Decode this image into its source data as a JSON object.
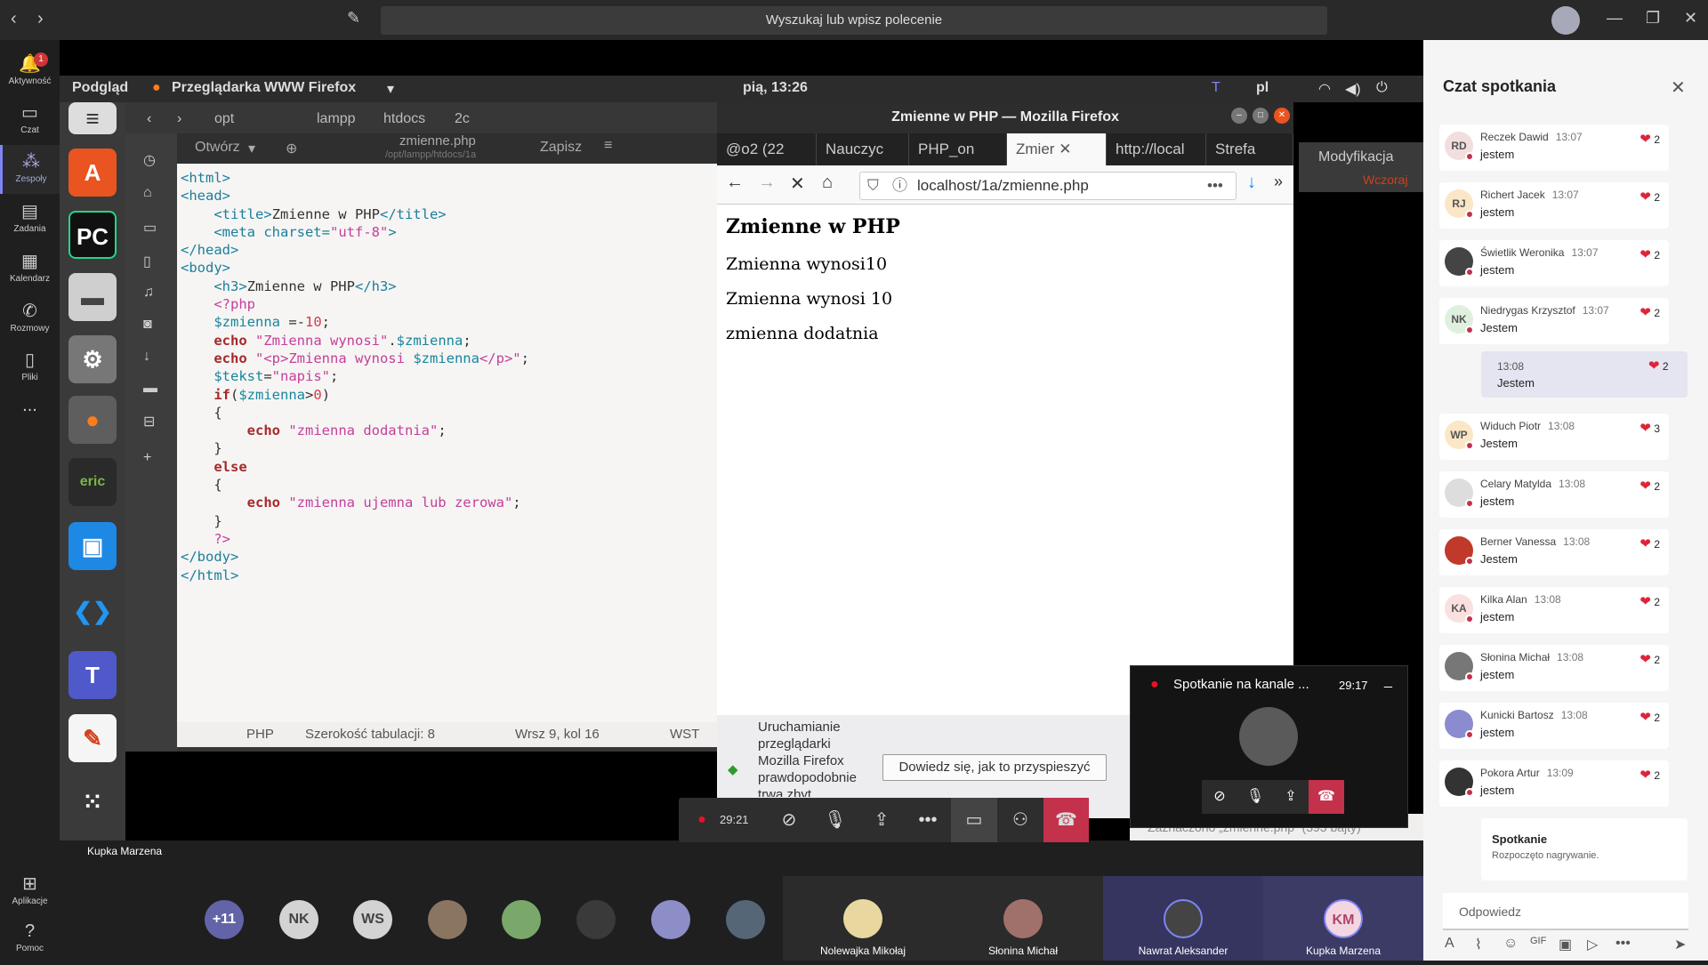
{
  "teams": {
    "search_placeholder": "Wyszukaj lub wpisz polecenie",
    "rail": [
      {
        "label": "Aktywność",
        "icon": "bell-icon",
        "badge": "1"
      },
      {
        "label": "Czat",
        "icon": "chat-icon"
      },
      {
        "label": "Zespoły",
        "icon": "teams-icon"
      },
      {
        "label": "Zadania",
        "icon": "assignments-icon"
      },
      {
        "label": "Kalendarz",
        "icon": "calendar-icon"
      },
      {
        "label": "Rozmowy",
        "icon": "phone-icon"
      },
      {
        "label": "Pliki",
        "icon": "files-icon"
      },
      {
        "label": "...",
        "icon": "more-icon"
      }
    ],
    "rail_bottom": [
      {
        "label": "Aplikacje",
        "icon": "apps-icon"
      },
      {
        "label": "Pomoc",
        "icon": "help-icon"
      }
    ]
  },
  "ubuntu": {
    "activities": "Podgląd",
    "app_menu": "Przeglądarka WWW Firefox",
    "clock": "pią, 13:26",
    "lang": "pl"
  },
  "gedit": {
    "breadcrumbs": [
      "opt",
      "lampp",
      "htdocs",
      "2c"
    ],
    "open_label": "Otwórz",
    "filename": "zmienne.php",
    "path": "/opt/lampp/htdocs/1a",
    "save_label": "Zapisz",
    "status": {
      "lang": "PHP",
      "tab_width": "Szerokość tabulacji: 8",
      "position": "Wrsz 9, kol 16",
      "mode": "WST"
    }
  },
  "firefox": {
    "window_title": "Zmienne w PHP — Mozilla Firefox",
    "tabs": [
      "@o2 (22",
      "Nauczyc",
      "PHP_on",
      "Zmier",
      "http://local",
      "Strefa"
    ],
    "url": "localhost/1a/zmienne.php",
    "page": {
      "heading": "Zmienne w PHP",
      "lines": [
        "Zmienna wynosi10",
        "Zmienna wynosi 10",
        "zmienna dodatnia"
      ]
    },
    "notice_text": "Uruchamianie przeglądarki Mozilla Firefox prawdopodobnie trwa zbyt",
    "notice_button": "Dowiedz się, jak to przyspieszyć"
  },
  "shared_right": {
    "modif_label": "Modyfikacja",
    "wczoraj": "Wczoraj",
    "status_bottom": "Zaznaczono „zmienne.php” (393 bajty)"
  },
  "call": {
    "timer": "29:21",
    "mini_title": "Spotkanie na kanale ...",
    "mini_timer": "29:17",
    "presenter": "Kupka Marzena"
  },
  "gallery": {
    "overflow": "+11",
    "avatars": [
      {
        "initials": "NK",
        "color": "#d3d3d3"
      },
      {
        "initials": "WS",
        "color": "#d3d3d3"
      }
    ],
    "tiles": [
      {
        "name": "Nolewajka Mikołaj"
      },
      {
        "name": "Słonina Michał"
      },
      {
        "name": "Nawrat Aleksander"
      },
      {
        "name": "Kupka Marzena",
        "initials": "KM"
      }
    ]
  },
  "chat": {
    "title": "Czat spotkania",
    "messages": [
      {
        "name": "Reczek Dawid",
        "time": "13:07",
        "text": "jestem",
        "reactions": "2",
        "initials": "RD",
        "color": "#f2dede"
      },
      {
        "name": "Richert Jacek",
        "time": "13:07",
        "text": "jestem",
        "reactions": "2",
        "initials": "RJ",
        "color": "#fbe6c6"
      },
      {
        "name": "Świetlik Weronika",
        "time": "13:07",
        "text": "jestem",
        "reactions": "2",
        "initials": "",
        "color": "#444"
      },
      {
        "name": "Niedrygas Krzysztof",
        "time": "13:07",
        "text": "Jestem",
        "reactions": "2",
        "initials": "NK",
        "color": "#dff0df"
      },
      {
        "name": "Widuch Piotr",
        "time": "13:08",
        "text": "Jestem",
        "reactions": "3",
        "initials": "WP",
        "color": "#fbe6c6"
      },
      {
        "name": "Celary Matylda",
        "time": "13:08",
        "text": "jestem",
        "reactions": "2",
        "initials": "",
        "color": "#ddd"
      },
      {
        "name": "Berner Vanessa",
        "time": "13:08",
        "text": "Jestem",
        "reactions": "2",
        "initials": "",
        "color": "#c0392b"
      },
      {
        "name": "Kilka Alan",
        "time": "13:08",
        "text": "jestem",
        "reactions": "2",
        "initials": "KA",
        "color": "#fbe0e0"
      },
      {
        "name": "Słonina Michał",
        "time": "13:08",
        "text": "jestem",
        "reactions": "2",
        "initials": "",
        "color": "#777"
      },
      {
        "name": "Kunicki Bartosz",
        "time": "13:08",
        "text": "jestem",
        "reactions": "2",
        "initials": "",
        "color": "#8b8bd0"
      },
      {
        "name": "Pokora Artur",
        "time": "13:09",
        "text": "jestem",
        "reactions": "2",
        "initials": "",
        "color": "#333"
      }
    ],
    "own_message": {
      "time": "13:08",
      "text": "Jestem",
      "reactions": "2"
    },
    "system": {
      "title": "Spotkanie",
      "text": "Rozpoczęto nagrywanie."
    },
    "reply_placeholder": "Odpowiedz"
  }
}
